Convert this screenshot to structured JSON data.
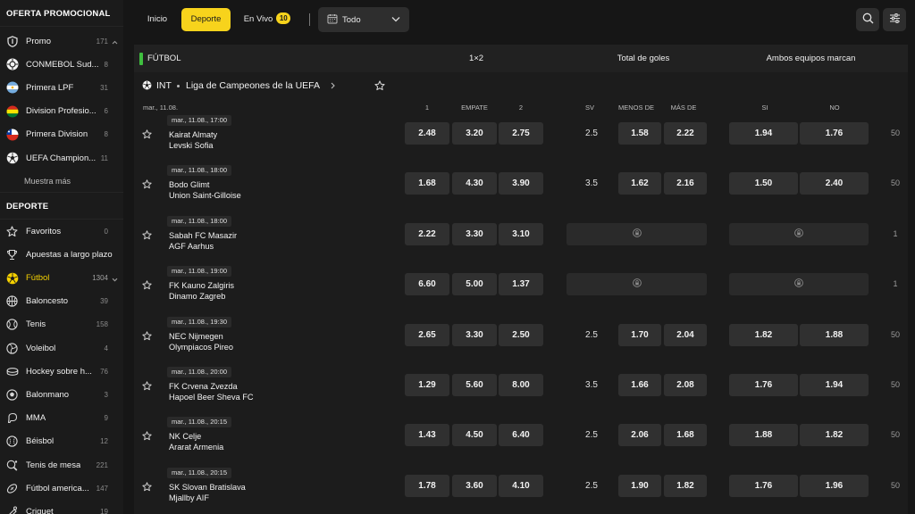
{
  "sidebar": {
    "promo_title": "OFERTA PROMOCIONAL",
    "promo_items": [
      {
        "label": "Promo",
        "count": "171",
        "icon": "shield-icon"
      },
      {
        "label": "CONMEBOL Sud...",
        "count": "8",
        "icon": "conmebol-logo-icon"
      },
      {
        "label": "Primera LPF",
        "count": "31",
        "icon": "argentina-flag-icon"
      },
      {
        "label": "Division Profesio...",
        "count": "6",
        "icon": "bolivia-flag-icon"
      },
      {
        "label": "Primera Division",
        "count": "8",
        "icon": "chile-flag-icon"
      },
      {
        "label": "UEFA Champion...",
        "count": "11",
        "icon": "soccer-ball-icon"
      }
    ],
    "show_more": "Muestra más",
    "sport_title": "DEPORTE",
    "sport_items": [
      {
        "label": "Favoritos",
        "count": "0",
        "icon": "star-icon"
      },
      {
        "label": "Apuestas a largo plazo",
        "count": "",
        "icon": "trophy-icon"
      },
      {
        "label": "Fútbol",
        "count": "1304",
        "icon": "soccer-ball-icon",
        "active": true
      },
      {
        "label": "Baloncesto",
        "count": "39",
        "icon": "basketball-icon"
      },
      {
        "label": "Tenis",
        "count": "158",
        "icon": "tennis-ball-icon"
      },
      {
        "label": "Voleibol",
        "count": "4",
        "icon": "volleyball-icon"
      },
      {
        "label": "Hockey sobre h...",
        "count": "76",
        "icon": "hockey-icon"
      },
      {
        "label": "Balonmano",
        "count": "3",
        "icon": "handball-icon"
      },
      {
        "label": "MMA",
        "count": "9",
        "icon": "glove-icon"
      },
      {
        "label": "Béisbol",
        "count": "12",
        "icon": "baseball-icon"
      },
      {
        "label": "Tenis de mesa",
        "count": "221",
        "icon": "table-tennis-icon"
      },
      {
        "label": "Fútbol america...",
        "count": "147",
        "icon": "american-football-icon"
      },
      {
        "label": "Criquet",
        "count": "19",
        "icon": "cricket-icon"
      }
    ]
  },
  "topbar": {
    "inicio": "Inicio",
    "deporte": "Deporte",
    "en_vivo": "En Vivo",
    "en_vivo_count": "10",
    "filter_value": "Todo"
  },
  "market_header": {
    "sport": "FÚTBOL",
    "col_1x2": "1×2",
    "col_total": "Total de goles",
    "col_btts": "Ambos equipos marcan"
  },
  "league": {
    "region": "INT",
    "name": "Liga de Campeones de la UEFA"
  },
  "columns": {
    "date": "mar., 11.08.",
    "one": "1",
    "draw": "EMPATE",
    "two": "2",
    "sv": "SV",
    "under": "MENOS DE",
    "over": "MÁS DE",
    "yes": "SI",
    "no": "NO"
  },
  "matches": [
    {
      "date": "mar., 11.08., 17:00",
      "home": "Kairat Almaty",
      "away": "Levski Sofia",
      "o1": "2.48",
      "ox": "3.20",
      "o2": "2.75",
      "line": "2.5",
      "under": "1.58",
      "over": "2.22",
      "yes": "1.94",
      "no": "1.76",
      "more": "50"
    },
    {
      "date": "mar., 11.08., 18:00",
      "home": "Bodo Glimt",
      "away": "Union Saint-Gilloise",
      "o1": "1.68",
      "ox": "4.30",
      "o2": "3.90",
      "line": "3.5",
      "under": "1.62",
      "over": "2.16",
      "yes": "1.50",
      "no": "2.40",
      "more": "50"
    },
    {
      "date": "mar., 11.08., 18:00",
      "home": "Sabah FC Masazir",
      "away": "AGF Aarhus",
      "o1": "2.22",
      "ox": "3.30",
      "o2": "3.10",
      "locked": true,
      "more": "1"
    },
    {
      "date": "mar., 11.08., 19:00",
      "home": "FK Kauno Zalgiris",
      "away": "Dinamo Zagreb",
      "o1": "6.60",
      "ox": "5.00",
      "o2": "1.37",
      "locked": true,
      "more": "1"
    },
    {
      "date": "mar., 11.08., 19:30",
      "home": "NEC Nijmegen",
      "away": "Olympiacos Pireo",
      "o1": "2.65",
      "ox": "3.30",
      "o2": "2.50",
      "line": "2.5",
      "under": "1.70",
      "over": "2.04",
      "yes": "1.82",
      "no": "1.88",
      "more": "50"
    },
    {
      "date": "mar., 11.08., 20:00",
      "home": "FK Crvena Zvezda",
      "away": "Hapoel Beer Sheva FC",
      "o1": "1.29",
      "ox": "5.60",
      "o2": "8.00",
      "line": "3.5",
      "under": "1.66",
      "over": "2.08",
      "yes": "1.76",
      "no": "1.94",
      "more": "50"
    },
    {
      "date": "mar., 11.08., 20:15",
      "home": "NK Celje",
      "away": "Ararat Armenia",
      "o1": "1.43",
      "ox": "4.50",
      "o2": "6.40",
      "line": "2.5",
      "under": "2.06",
      "over": "1.68",
      "yes": "1.88",
      "no": "1.82",
      "more": "50"
    },
    {
      "date": "mar., 11.08., 20:15",
      "home": "SK Slovan Bratislava",
      "away": "Mjallby AIF",
      "o1": "1.78",
      "ox": "3.60",
      "o2": "4.10",
      "line": "2.5",
      "under": "1.90",
      "over": "1.82",
      "yes": "1.76",
      "no": "1.96",
      "more": "50"
    }
  ],
  "colors": {
    "accent": "#f7d31c",
    "active_green": "#3fbf3f"
  }
}
